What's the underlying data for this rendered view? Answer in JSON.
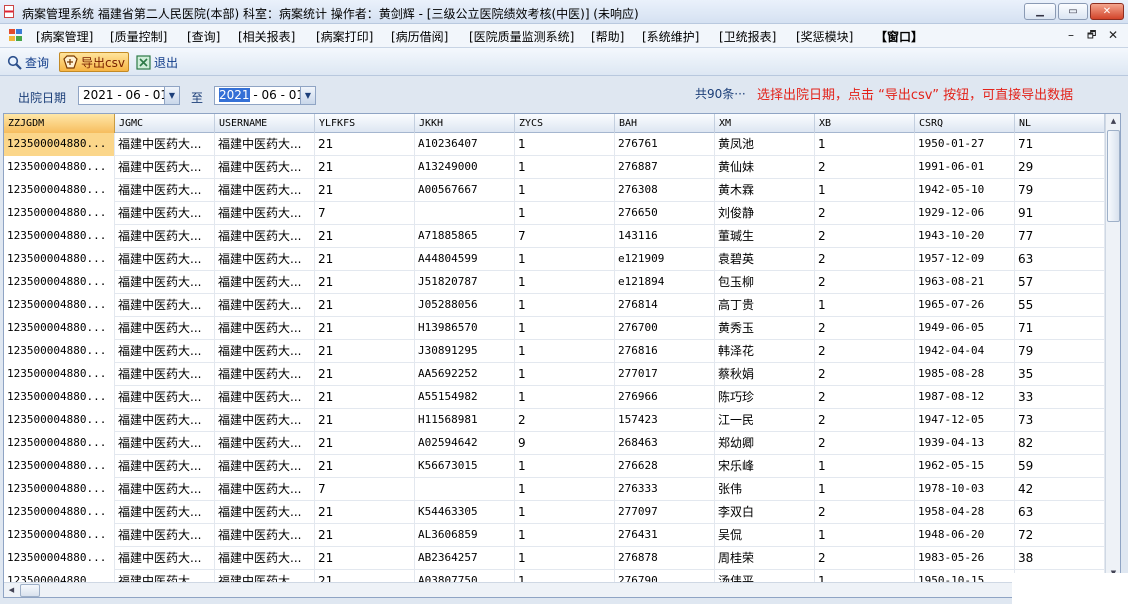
{
  "window": {
    "title": "病案管理系统  福建省第二人民医院(本部)  科室：病案统计  操作者：黄剑辉 - [三级公立医院绩效考核(中医)] (未响应)",
    "minimize": "▁",
    "maximize": "▭",
    "close": "✕"
  },
  "menu": {
    "items": [
      "[病案管理]",
      "[质量控制]",
      "[查询]",
      "[相关报表]",
      "[病案打印]",
      "[病历借阅]",
      "[医院质量监测系统]",
      "[帮助]",
      "[系统维护]",
      "[卫统报表]",
      "[奖惩模块]",
      "【窗口】"
    ],
    "mdi_min": "–",
    "mdi_restore": "🗗",
    "mdi_close": "✕"
  },
  "toolbar": {
    "query_label": "查询",
    "export_label": "导出csv",
    "exit_label": "退出"
  },
  "filter": {
    "label": "出院日期",
    "from_value": "2021 - 06 - 01",
    "to_label": "至",
    "to_year": "2021",
    "to_rest": " - 06 - 01",
    "dropdown_glyph": "▼",
    "count": "共90条···",
    "hint": "选择出院日期，点击 “导出csv” 按钮，可直接导出数据"
  },
  "table": {
    "columns": [
      "ZZJGDM",
      "JGMC",
      "USERNAME",
      "YLFKFS",
      "JKKH",
      "ZYCS",
      "BAH",
      "XM",
      "XB",
      "CSRQ",
      "NL"
    ],
    "rows": [
      [
        "123500004880...",
        "福建中医药大...",
        "福建中医药大...",
        "21",
        "A10236407",
        "1",
        "276761",
        "黄凤池",
        "1",
        "1950-01-27",
        "71"
      ],
      [
        "123500004880...",
        "福建中医药大...",
        "福建中医药大...",
        "21",
        "A13249000",
        "1",
        "276887",
        "黄仙妹",
        "2",
        "1991-06-01",
        "29"
      ],
      [
        "123500004880...",
        "福建中医药大...",
        "福建中医药大...",
        "21",
        "A00567667",
        "1",
        "276308",
        "黄木霖",
        "1",
        "1942-05-10",
        "79"
      ],
      [
        "123500004880...",
        "福建中医药大...",
        "福建中医药大...",
        "7",
        "",
        "1",
        "276650",
        "刘俊静",
        "2",
        "1929-12-06",
        "91"
      ],
      [
        "123500004880...",
        "福建中医药大...",
        "福建中医药大...",
        "21",
        "A71885865",
        "7",
        "143116",
        "董瑊生",
        "2",
        "1943-10-20",
        "77"
      ],
      [
        "123500004880...",
        "福建中医药大...",
        "福建中医药大...",
        "21",
        "A44804599",
        "1",
        "e121909",
        "袁碧英",
        "2",
        "1957-12-09",
        "63"
      ],
      [
        "123500004880...",
        "福建中医药大...",
        "福建中医药大...",
        "21",
        "J51820787",
        "1",
        "e121894",
        "包玉柳",
        "2",
        "1963-08-21",
        "57"
      ],
      [
        "123500004880...",
        "福建中医药大...",
        "福建中医药大...",
        "21",
        "J05288056",
        "1",
        "276814",
        "高丁贵",
        "1",
        "1965-07-26",
        "55"
      ],
      [
        "123500004880...",
        "福建中医药大...",
        "福建中医药大...",
        "21",
        "H13986570",
        "1",
        "276700",
        "黄秀玉",
        "2",
        "1949-06-05",
        "71"
      ],
      [
        "123500004880...",
        "福建中医药大...",
        "福建中医药大...",
        "21",
        "J30891295",
        "1",
        "276816",
        "韩泽花",
        "2",
        "1942-04-04",
        "79"
      ],
      [
        "123500004880...",
        "福建中医药大...",
        "福建中医药大...",
        "21",
        "AA5692252",
        "1",
        "277017",
        "蔡秋娟",
        "2",
        "1985-08-28",
        "35"
      ],
      [
        "123500004880...",
        "福建中医药大...",
        "福建中医药大...",
        "21",
        "A55154982",
        "1",
        "276966",
        "陈巧珍",
        "2",
        "1987-08-12",
        "33"
      ],
      [
        "123500004880...",
        "福建中医药大...",
        "福建中医药大...",
        "21",
        "H11568981",
        "2",
        "157423",
        "江一民",
        "2",
        "1947-12-05",
        "73"
      ],
      [
        "123500004880...",
        "福建中医药大...",
        "福建中医药大...",
        "21",
        "A02594642",
        "9",
        "268463",
        "郑幼卿",
        "2",
        "1939-04-13",
        "82"
      ],
      [
        "123500004880...",
        "福建中医药大...",
        "福建中医药大...",
        "21",
        "K56673015",
        "1",
        "276628",
        "宋乐峰",
        "1",
        "1962-05-15",
        "59"
      ],
      [
        "123500004880...",
        "福建中医药大...",
        "福建中医药大...",
        "7",
        "",
        "1",
        "276333",
        "张伟",
        "1",
        "1978-10-03",
        "42"
      ],
      [
        "123500004880...",
        "福建中医药大...",
        "福建中医药大...",
        "21",
        "K54463305",
        "1",
        "277097",
        "李双白",
        "2",
        "1958-04-28",
        "63"
      ],
      [
        "123500004880...",
        "福建中医药大...",
        "福建中医药大...",
        "21",
        "AL3606859",
        "1",
        "276431",
        "吴侃",
        "1",
        "1948-06-20",
        "72"
      ],
      [
        "123500004880...",
        "福建中医药大...",
        "福建中医药大...",
        "21",
        "AB2364257",
        "1",
        "276878",
        "周桂荣",
        "2",
        "1983-05-26",
        "38"
      ],
      [
        "123500004880...",
        "福建中医药大...",
        "福建中医药大...",
        "21",
        "A03807750",
        "1",
        "276790",
        "汤伟平",
        "1",
        "1950-10-15",
        ""
      ]
    ]
  },
  "colors": {
    "accent": "#f7b545",
    "hint_red": "#e3231a",
    "selected_cell": "#fbd68a",
    "date_highlight": "#3470d6"
  }
}
